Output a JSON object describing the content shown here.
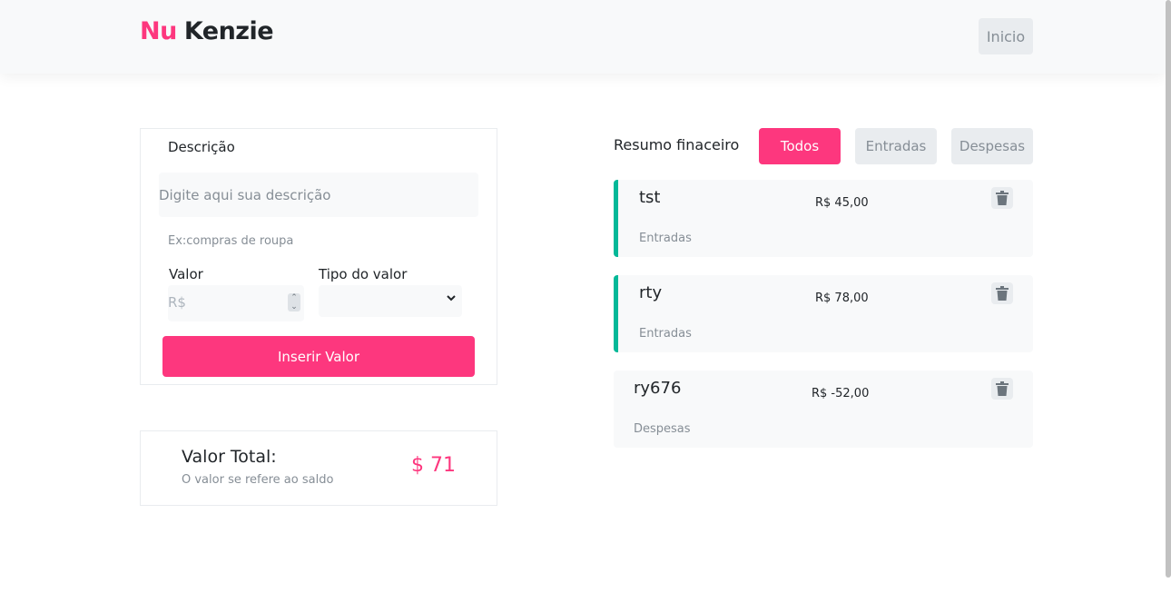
{
  "header": {
    "logo_nu": "Nu",
    "logo_kenzie": "Kenzie",
    "inicio_label": "Inicio"
  },
  "form": {
    "descricao_label": "Descrição",
    "descricao_placeholder": "Digite aqui sua descrição",
    "hint": "Ex:compras de roupa",
    "valor_label": "Valor",
    "valor_placeholder": "R$",
    "tipo_label": "Tipo do valor",
    "tipo_selected": "",
    "submit_label": "Inserir Valor"
  },
  "total": {
    "title": "Valor Total:",
    "subtitle": "O valor se refere ao saldo",
    "amount": "$ 71"
  },
  "resumo": {
    "title": "Resumo finaceiro",
    "filters": [
      "Todos",
      "Entradas",
      "Despesas"
    ],
    "active_filter": "Todos"
  },
  "entries": [
    {
      "name": "tst",
      "value": "R$ 45,00",
      "type": "Entradas"
    },
    {
      "name": "rty",
      "value": "R$ 78,00",
      "type": "Entradas"
    },
    {
      "name": "ry676",
      "value": "R$ -52,00",
      "type": "Despesas"
    }
  ],
  "colors": {
    "brand_pink": "#fd377e",
    "income_green": "#03b898",
    "grey_bg": "#f8f9fa",
    "grey_btn": "#e9ecef"
  }
}
